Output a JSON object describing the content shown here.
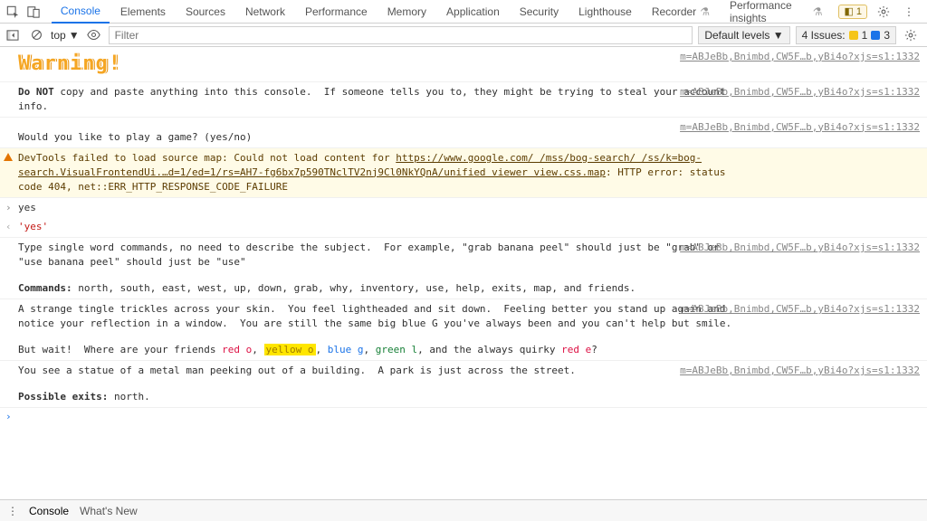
{
  "header": {
    "tabs": [
      {
        "label": "Console",
        "active": true
      },
      {
        "label": "Elements"
      },
      {
        "label": "Sources"
      },
      {
        "label": "Network"
      },
      {
        "label": "Performance"
      },
      {
        "label": "Memory"
      },
      {
        "label": "Application"
      },
      {
        "label": "Security"
      },
      {
        "label": "Lighthouse"
      },
      {
        "label": "Recorder",
        "experimental": true
      },
      {
        "label": "Performance insights",
        "experimental": true
      }
    ],
    "warn_badge": "1"
  },
  "toolbar": {
    "context": "top",
    "filter_placeholder": "Filter",
    "levels_label": "Default levels",
    "issues_label": "4 Issues:",
    "issues_warn": "1",
    "issues_info": "3"
  },
  "src_link": "m=ABJeBb,Bnimbd,CW5F…b,yBi4o?xjs=s1:1332",
  "logs": {
    "warning_banner": "Warning!",
    "do_not": "Do NOT",
    "do_not_rest": " copy and paste anything into this console.  If someone tells you to, they might be trying to steal your account info.",
    "play_prompt": "Would you like to play a game? (yes/no)",
    "sourcemap_a": "DevTools failed to load source map: Could not load content for ",
    "sourcemap_link": "https://www.google.com/ /mss/bog-search/ /ss/k=bog-search.VisualFrontendUi.…d=1/ed=1/rs=AH7-fg6bx7p590TNclTV2nj9Cl0NkYQnA/unified viewer view.css.map",
    "sourcemap_b": ": HTTP error: status code 404, net::ERR_HTTP_RESPONSE_CODE_FAILURE",
    "input_yes": "yes",
    "eval_yes": "'yes'",
    "cmds_intro": "Type single word commands, no need to describe the subject.  For example, \"grab banana peel\" should just be \"grab\" or \"use banana peel\" should just be \"use\"",
    "cmds_label": "Commands:",
    "cmds_list": " north, south, east, west, up, down, grab, why, inventory, use, help, exits, map, and friends.",
    "tingle": "A strange tingle trickles across your skin.  You feel lightheaded and sit down.  Feeling better you stand up again and notice your reflection in a window.  You are still the same big blue G you've always been and you can't help but smile.",
    "butwait_a": "But wait!  Where are your friends ",
    "red_o": "red o",
    "sep1": ", ",
    "yellow_o": "yellow o",
    "sep2": ", ",
    "blue_g": "blue g",
    "sep3": ", ",
    "green_l": "green l",
    "butwait_b": ", and the always quirky ",
    "red_e": "red e",
    "butwait_c": "?",
    "statue": "You see a statue of a metal man peeking out of a building.  A park is just across the street.",
    "exits_label": "Possible exits:",
    "exits_val": " north."
  },
  "bottom": {
    "console": "Console",
    "whatsnew": "What's New"
  }
}
